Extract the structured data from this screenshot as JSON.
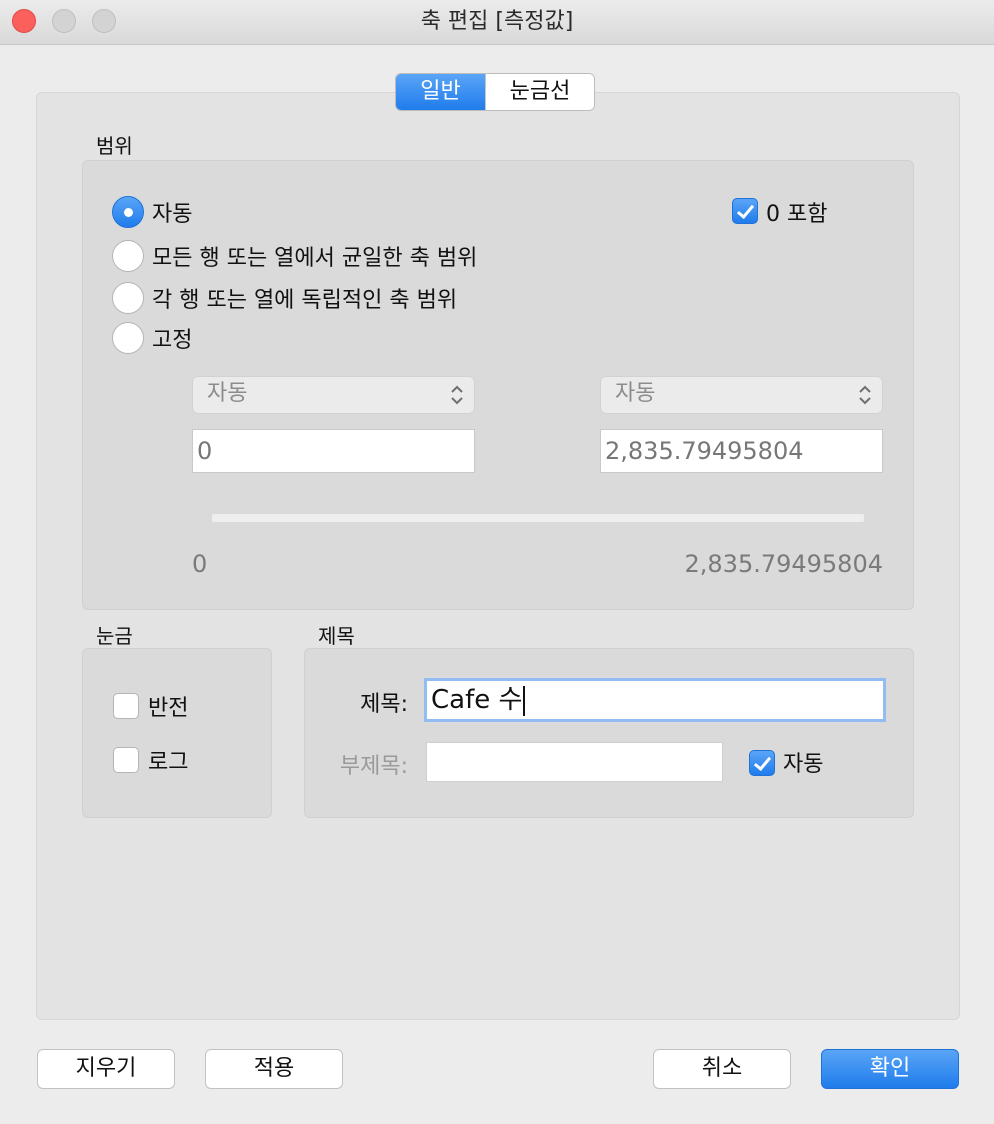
{
  "window": {
    "title": "축 편집 [측정값]"
  },
  "tabs": [
    {
      "label": "일반",
      "active": true
    },
    {
      "label": "눈금선",
      "active": false
    }
  ],
  "range": {
    "section_label": "범위",
    "options": [
      {
        "label": "자동",
        "selected": true
      },
      {
        "label": "모든 행 또는 열에서 균일한 축 범위",
        "selected": false
      },
      {
        "label": "각 행 또는 열에 독립적인 축 범위",
        "selected": false
      },
      {
        "label": "고정",
        "selected": false
      }
    ],
    "include_zero": {
      "label": "0 포함",
      "checked": true
    },
    "start": {
      "mode": "자동",
      "value": "0"
    },
    "end": {
      "mode": "자동",
      "value": "2,835.79495804"
    },
    "slider_min_label": "0",
    "slider_max_label": "2,835.79495804"
  },
  "scale": {
    "section_label": "눈금",
    "reversed": {
      "label": "반전",
      "checked": false
    },
    "logarithmic": {
      "label": "로그",
      "checked": false
    }
  },
  "axis_title": {
    "section_label": "제목",
    "title_label": "제목:",
    "title_value": "Cafe 수",
    "subtitle_label": "부제목:",
    "subtitle_value": "",
    "subtitle_auto": {
      "label": "자동",
      "checked": true
    }
  },
  "buttons": {
    "clear": "지우기",
    "apply": "적용",
    "cancel": "취소",
    "ok": "확인"
  },
  "colors": {
    "accent": "#2f88f1",
    "close": "#fc605c"
  }
}
